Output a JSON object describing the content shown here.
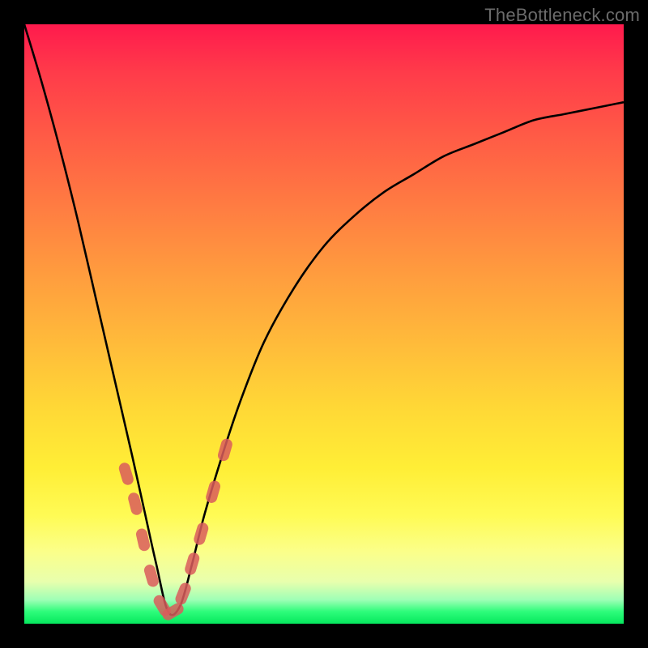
{
  "watermark": "TheBottleneck.com",
  "colors": {
    "frame": "#000000",
    "gradient_top": "#ff1a4d",
    "gradient_bottom": "#06e85e",
    "curve": "#000000",
    "marker": "#d95c5c"
  },
  "chart_data": {
    "type": "line",
    "title": "",
    "xlabel": "",
    "ylabel": "",
    "xlim": [
      0,
      100
    ],
    "ylim": [
      0,
      100
    ],
    "grid": false,
    "legend": false,
    "note": "Axes are unlabeled; values are read as percentage of plot width (x) and percentage of plot height from bottom (y). Curve dips to ~0 near x≈24 then rises and flattens toward the right.",
    "series": [
      {
        "name": "curve",
        "x": [
          0,
          3,
          6,
          9,
          12,
          15,
          18,
          20,
          22,
          24,
          26,
          28,
          30,
          33,
          36,
          40,
          45,
          50,
          55,
          60,
          65,
          70,
          75,
          80,
          85,
          90,
          95,
          100
        ],
        "y": [
          100,
          90,
          79,
          67,
          54,
          41,
          28,
          19,
          10,
          2,
          3,
          10,
          18,
          28,
          37,
          47,
          56,
          63,
          68,
          72,
          75,
          78,
          80,
          82,
          84,
          85,
          86,
          87
        ]
      }
    ],
    "markers": {
      "name": "highlighted-points",
      "description": "Rounded salmon capsule markers placed along the lower V portion of the curve",
      "points": [
        {
          "x": 17.0,
          "y": 25
        },
        {
          "x": 18.5,
          "y": 20
        },
        {
          "x": 19.8,
          "y": 14
        },
        {
          "x": 21.2,
          "y": 8
        },
        {
          "x": 23.0,
          "y": 3
        },
        {
          "x": 24.8,
          "y": 2
        },
        {
          "x": 26.5,
          "y": 5
        },
        {
          "x": 28.0,
          "y": 10
        },
        {
          "x": 29.5,
          "y": 15
        },
        {
          "x": 31.5,
          "y": 22
        },
        {
          "x": 33.5,
          "y": 29
        }
      ]
    }
  }
}
